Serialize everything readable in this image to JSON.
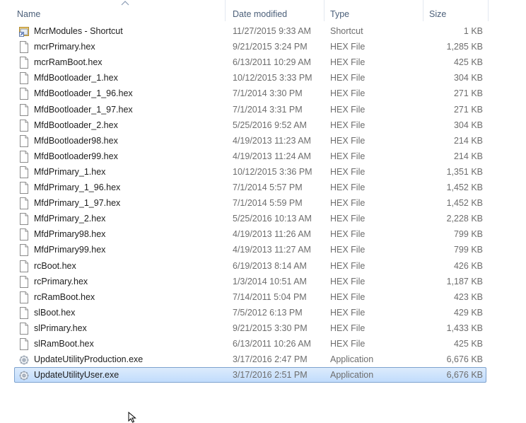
{
  "columns": {
    "name": "Name",
    "date": "Date modified",
    "type": "Type",
    "size": "Size"
  },
  "files": [
    {
      "name": "McrModules - Shortcut",
      "date": "11/27/2015 9:33 AM",
      "type": "Shortcut",
      "size": "1 KB",
      "icon": "shortcut-icon"
    },
    {
      "name": "mcrPrimary.hex",
      "date": "9/21/2015 3:24 PM",
      "type": "HEX File",
      "size": "1,285 KB",
      "icon": "file-icon"
    },
    {
      "name": "mcrRamBoot.hex",
      "date": "6/13/2011 10:29 AM",
      "type": "HEX File",
      "size": "425 KB",
      "icon": "file-icon"
    },
    {
      "name": "MfdBootloader_1.hex",
      "date": "10/12/2015 3:33 PM",
      "type": "HEX File",
      "size": "304 KB",
      "icon": "file-icon"
    },
    {
      "name": "MfdBootloader_1_96.hex",
      "date": "7/1/2014 3:30 PM",
      "type": "HEX File",
      "size": "271 KB",
      "icon": "file-icon"
    },
    {
      "name": "MfdBootloader_1_97.hex",
      "date": "7/1/2014 3:31 PM",
      "type": "HEX File",
      "size": "271 KB",
      "icon": "file-icon"
    },
    {
      "name": "MfdBootloader_2.hex",
      "date": "5/25/2016 9:52 AM",
      "type": "HEX File",
      "size": "304 KB",
      "icon": "file-icon"
    },
    {
      "name": "MfdBootloader98.hex",
      "date": "4/19/2013 11:23 AM",
      "type": "HEX File",
      "size": "214 KB",
      "icon": "file-icon"
    },
    {
      "name": "MfdBootloader99.hex",
      "date": "4/19/2013 11:24 AM",
      "type": "HEX File",
      "size": "214 KB",
      "icon": "file-icon"
    },
    {
      "name": "MfdPrimary_1.hex",
      "date": "10/12/2015 3:36 PM",
      "type": "HEX File",
      "size": "1,351 KB",
      "icon": "file-icon"
    },
    {
      "name": "MfdPrimary_1_96.hex",
      "date": "7/1/2014 5:57 PM",
      "type": "HEX File",
      "size": "1,452 KB",
      "icon": "file-icon"
    },
    {
      "name": "MfdPrimary_1_97.hex",
      "date": "7/1/2014 5:59 PM",
      "type": "HEX File",
      "size": "1,452 KB",
      "icon": "file-icon"
    },
    {
      "name": "MfdPrimary_2.hex",
      "date": "5/25/2016 10:13 AM",
      "type": "HEX File",
      "size": "2,228 KB",
      "icon": "file-icon"
    },
    {
      "name": "MfdPrimary98.hex",
      "date": "4/19/2013 11:26 AM",
      "type": "HEX File",
      "size": "799 KB",
      "icon": "file-icon"
    },
    {
      "name": "MfdPrimary99.hex",
      "date": "4/19/2013 11:27 AM",
      "type": "HEX File",
      "size": "799 KB",
      "icon": "file-icon"
    },
    {
      "name": "rcBoot.hex",
      "date": "6/19/2013 8:14 AM",
      "type": "HEX File",
      "size": "426 KB",
      "icon": "file-icon"
    },
    {
      "name": "rcPrimary.hex",
      "date": "1/3/2014 10:51 AM",
      "type": "HEX File",
      "size": "1,187 KB",
      "icon": "file-icon"
    },
    {
      "name": "rcRamBoot.hex",
      "date": "7/14/2011 5:04 PM",
      "type": "HEX File",
      "size": "423 KB",
      "icon": "file-icon"
    },
    {
      "name": "slBoot.hex",
      "date": "7/5/2012 6:13 PM",
      "type": "HEX File",
      "size": "429 KB",
      "icon": "file-icon"
    },
    {
      "name": "slPrimary.hex",
      "date": "9/21/2015 3:30 PM",
      "type": "HEX File",
      "size": "1,433 KB",
      "icon": "file-icon"
    },
    {
      "name": "slRamBoot.hex",
      "date": "6/13/2011 10:26 AM",
      "type": "HEX File",
      "size": "425 KB",
      "icon": "file-icon"
    },
    {
      "name": "UpdateUtilityProduction.exe",
      "date": "3/17/2016 2:47 PM",
      "type": "Application",
      "size": "6,676 KB",
      "icon": "application-icon"
    },
    {
      "name": "UpdateUtilityUser.exe",
      "date": "3/17/2016 2:51 PM",
      "type": "Application",
      "size": "6,676 KB",
      "icon": "application-icon",
      "selected": true
    }
  ],
  "colors": {
    "header_text": "#4c607a",
    "name_text": "#1e1e1e",
    "detail_text": "#6d6d6d",
    "selection_border": "#7da2ce",
    "selection_fill": "#c9e0fc"
  }
}
